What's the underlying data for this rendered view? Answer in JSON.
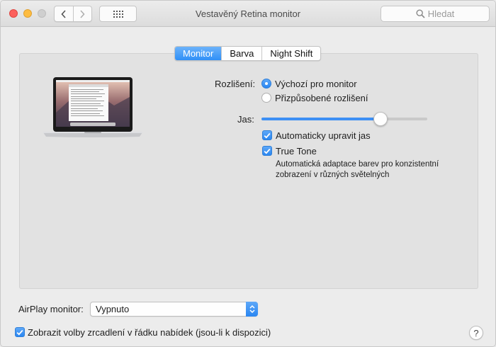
{
  "window": {
    "title": "Vestavěný Retina monitor"
  },
  "toolbar": {
    "search_placeholder": "Hledat"
  },
  "tabs": [
    {
      "label": "Monitor",
      "active": true
    },
    {
      "label": "Barva",
      "active": false
    },
    {
      "label": "Night Shift",
      "active": false
    }
  ],
  "resolution": {
    "label": "Rozlišení:",
    "options": [
      {
        "label": "Výchozí pro monitor",
        "selected": true
      },
      {
        "label": "Přizpůsobené rozlišení",
        "selected": false
      }
    ]
  },
  "brightness": {
    "label": "Jas:",
    "level": 0.72,
    "auto_label": "Automaticky upravit jas",
    "auto_checked": true
  },
  "true_tone": {
    "label": "True Tone",
    "checked": true,
    "description": "Automatická adaptace barev pro konzistentní zobrazení v různých světelných"
  },
  "airplay": {
    "label": "AirPlay monitor:",
    "value": "Vypnuto"
  },
  "mirror_option": {
    "label": "Zobrazit volby zrcadlení v řádku nabídek (jsou-li k dispozici)",
    "checked": true
  },
  "help_label": "?",
  "colors": {
    "accent": "#2f8ff7",
    "close": "#fc605c",
    "minimize": "#fdbc40"
  }
}
